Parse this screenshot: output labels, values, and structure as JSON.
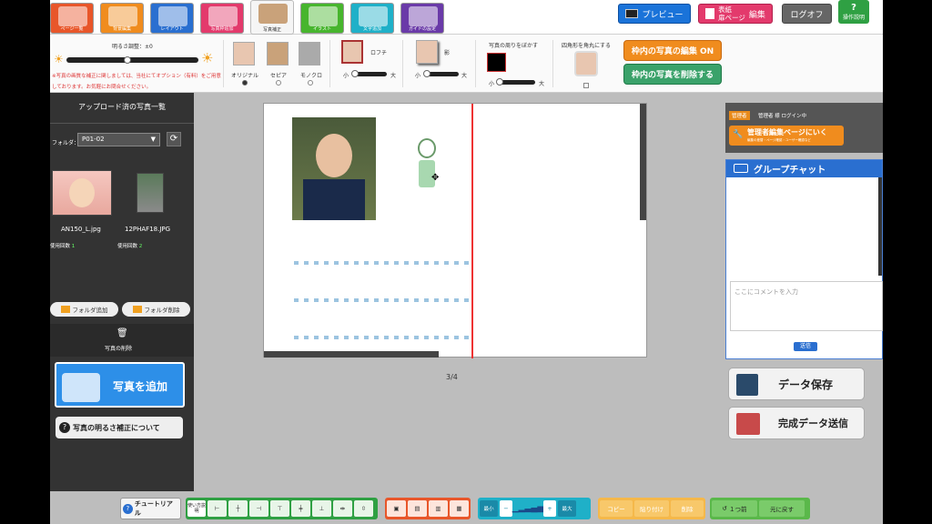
{
  "tabs": [
    {
      "label": "ページ一覧",
      "color": "#e8562a"
    },
    {
      "label": "背景編集",
      "color": "#f08c1e"
    },
    {
      "label": "レイアウト",
      "color": "#2a6fd0"
    },
    {
      "label": "写真枠追加",
      "color": "#e33a6c"
    },
    {
      "label": "写真補正",
      "color": "#f5f5f5"
    },
    {
      "label": "イラスト",
      "color": "#47b52e"
    },
    {
      "label": "文字追加",
      "color": "#1fb0c8"
    },
    {
      "label": "ガイドの設定",
      "color": "#6a3aa8"
    }
  ],
  "header": {
    "preview": "プレビュー",
    "cover_edit_line1": "表紙",
    "cover_edit_line2": "扉ページ",
    "cover_edit_suffix": "編集",
    "logoff": "ログオフ",
    "manual": "操作説明",
    "manual_icon": "?"
  },
  "tools": {
    "brightness_label": "明るさ調整：±0",
    "note": "※写真の画質な補正に関しましては、当社にてオプション（有料）をご用意しております。お気軽にお問合せください。",
    "filters": [
      "オリジナル",
      "セピア",
      "モノクロ"
    ],
    "border_label": "ロフチ",
    "shadow_label": "影",
    "small": "小",
    "large": "大",
    "blur_label": "写真の周りをぼかす",
    "round_label": "四角形を角丸にする",
    "edit_on": "枠内の写真の編集 ON",
    "delete_in_frame": "枠内の写真を削除する"
  },
  "left": {
    "title": "アップロード済の写真一覧",
    "folder_label": "フォルダ：",
    "folder_value": "P01-02",
    "photos": [
      {
        "name": "AN150_L.jpg",
        "usage_label": "使用回数",
        "usage": "1"
      },
      {
        "name": "12PHAF18.JPG",
        "usage_label": "使用回数",
        "usage": "2"
      }
    ],
    "add_folder": "フォルダ追加",
    "delete_folder": "フォルダ削除",
    "delete_photo": "写真の削除",
    "add_photo": "写真を追加",
    "brightness_help": "写真の明るさ補正について",
    "help_icon": "?"
  },
  "canvas": {
    "page_indicator": "3/4"
  },
  "right": {
    "admin_badge": "管理者",
    "login_text": "管理者 様 ログイン中",
    "admin_link": "管理者編集ページにいく",
    "admin_link_sub": "編集の差替・ページ確認・ユーザー確認など",
    "chat_title": "グループチャット",
    "comment_placeholder": "ここにコメントを入力",
    "send": "送信",
    "save": "データ保存",
    "submit": "完成データ送信"
  },
  "bottom": {
    "tutorial": "チュートリアル",
    "usage": "使い方説明",
    "zoom_min": "最小",
    "zoom_max": "最大",
    "copy": "コピー",
    "paste": "貼り付け",
    "delete": "削除",
    "undo": "１つ前",
    "redo": "元に戻す"
  }
}
